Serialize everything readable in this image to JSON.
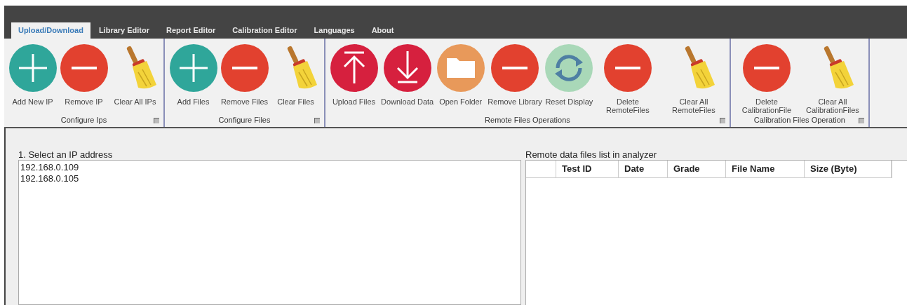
{
  "tabs": [
    {
      "label": "Upload/Download",
      "selected": true
    },
    {
      "label": "Library Editor",
      "selected": false
    },
    {
      "label": "Report Editor",
      "selected": false
    },
    {
      "label": "Calibration Editor",
      "selected": false
    },
    {
      "label": "Languages",
      "selected": false
    },
    {
      "label": "About",
      "selected": false
    }
  ],
  "ribbon_groups": [
    {
      "label": "Configure Ips",
      "buttons": [
        {
          "kind": "add",
          "label": "Add New IP"
        },
        {
          "kind": "remove",
          "label": "Remove IP"
        },
        {
          "kind": "broom",
          "label": "Clear All IPs"
        }
      ]
    },
    {
      "label": "Configure Files",
      "buttons": [
        {
          "kind": "add",
          "label": "Add Files"
        },
        {
          "kind": "remove",
          "label": "Remove Files"
        },
        {
          "kind": "broom",
          "label": "Clear Files"
        }
      ]
    },
    {
      "label": "Remote Files Operations",
      "buttons": [
        {
          "kind": "upload",
          "label": "Upload Files"
        },
        {
          "kind": "download",
          "label": "Download Data"
        },
        {
          "kind": "folder",
          "label": "Open Folder"
        },
        {
          "kind": "remove",
          "label": "Remove Library"
        },
        {
          "kind": "refresh",
          "label": "Reset Display"
        },
        {
          "kind": "remove",
          "label": "Delete RemoteFiles"
        },
        {
          "kind": "broom",
          "label": "Clear All RemoteFiles"
        }
      ]
    },
    {
      "label": "Calibration Files Operation",
      "buttons": [
        {
          "kind": "remove",
          "label": "Delete CalibrationFile"
        },
        {
          "kind": "broom",
          "label": "Clear All CalibrationFiles"
        }
      ]
    }
  ],
  "ip_panel": {
    "label": "1. Select an IP address",
    "items": [
      "192.168.0.109",
      "192.168.0.105"
    ]
  },
  "remote_panel": {
    "label": "Remote data files list in analyzer",
    "columns": [
      "Test ID",
      "Date",
      "Grade",
      "File Name",
      "Size (Byte)"
    ]
  }
}
